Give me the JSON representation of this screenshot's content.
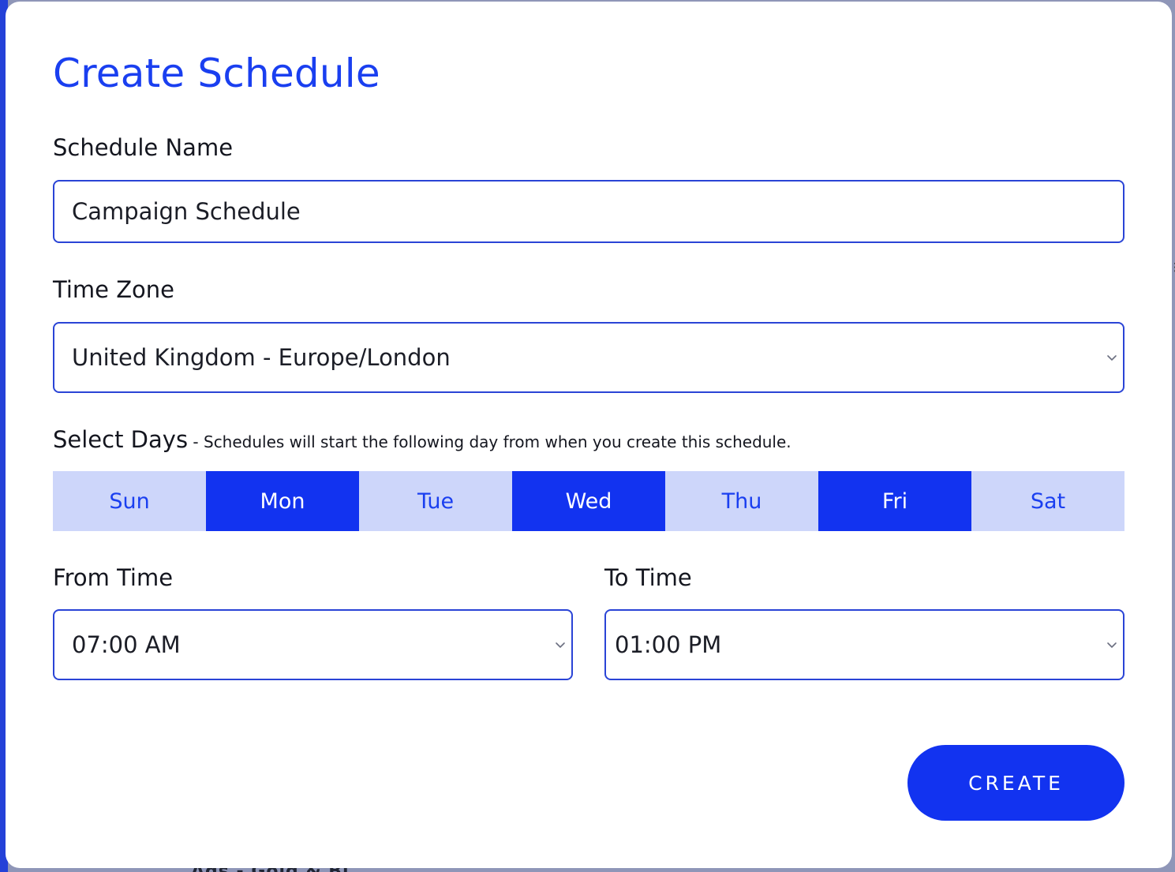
{
  "background": {
    "peek_text": "Ads - Gold & Bl"
  },
  "modal": {
    "title": "Create Schedule",
    "schedule_name": {
      "label": "Schedule Name",
      "value": "Campaign Schedule"
    },
    "time_zone": {
      "label": "Time Zone",
      "value": "United Kingdom - Europe/London"
    },
    "select_days": {
      "label": "Select Days",
      "note": " - Schedules will start the following day from when you create this schedule.",
      "days": [
        {
          "label": "Sun",
          "selected": false
        },
        {
          "label": "Mon",
          "selected": true
        },
        {
          "label": "Tue",
          "selected": false
        },
        {
          "label": "Wed",
          "selected": true
        },
        {
          "label": "Thu",
          "selected": false
        },
        {
          "label": "Fri",
          "selected": true
        },
        {
          "label": "Sat",
          "selected": false
        }
      ]
    },
    "from_time": {
      "label": "From Time",
      "value": "07:00 AM"
    },
    "to_time": {
      "label": "To Time",
      "value": "01:00 PM"
    },
    "create_label": "CREATE"
  },
  "colors": {
    "accent": "#1233f0",
    "day_unselected_bg": "#cdd6fa",
    "field_border": "#2a44d6",
    "overlay": "#8f96b8"
  },
  "icons": {
    "select_arrow": "chevron-down-icon"
  }
}
